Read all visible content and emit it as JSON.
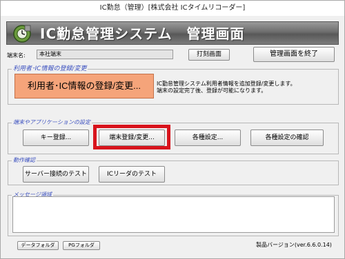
{
  "window": {
    "title": "IC勤怠（管理）[株式会社 ICタイムリコーダー]"
  },
  "header": {
    "title": "IC勤怠管理システム　管理画面"
  },
  "terminal": {
    "label": "端末名:",
    "value": "本社端末"
  },
  "toolbar": {
    "print_label": "打刻画面",
    "exit_label": "管理画面を終了"
  },
  "user_section": {
    "label": "利用者･IC情報の登録/変更",
    "button_label": "利用者･IC情報の登録/変更...",
    "description": [
      "IC勤怠管理システム利用者情報を追加登録/変更します。",
      "端末の設定完了後、登録が可能になります。"
    ]
  },
  "settings_section": {
    "label": "端末やアプリケーションの設定",
    "key_label": "キー登録...",
    "terminal_label": "端末登録/変更...",
    "misc_label": "各種設定...",
    "confirm_label": "各種設定の確認"
  },
  "check_section": {
    "label": "動作確認",
    "server_test_label": "サーバー接続のテスト",
    "ic_reader_test_label": "ICリーダのテスト"
  },
  "message_section": {
    "label": "メッセージ領域",
    "text": ""
  },
  "footer": {
    "data_folder_label": "データフォルダ",
    "pg_folder_label": "PGフォルダ",
    "version": "製品バージョン(ver.6.6.0.14)"
  },
  "colors": {
    "highlight": "#d8131c",
    "accent_button": "#f5a47a",
    "group_label": "#3a4fbf"
  },
  "icons": {
    "app": "clock-gear-icon"
  }
}
